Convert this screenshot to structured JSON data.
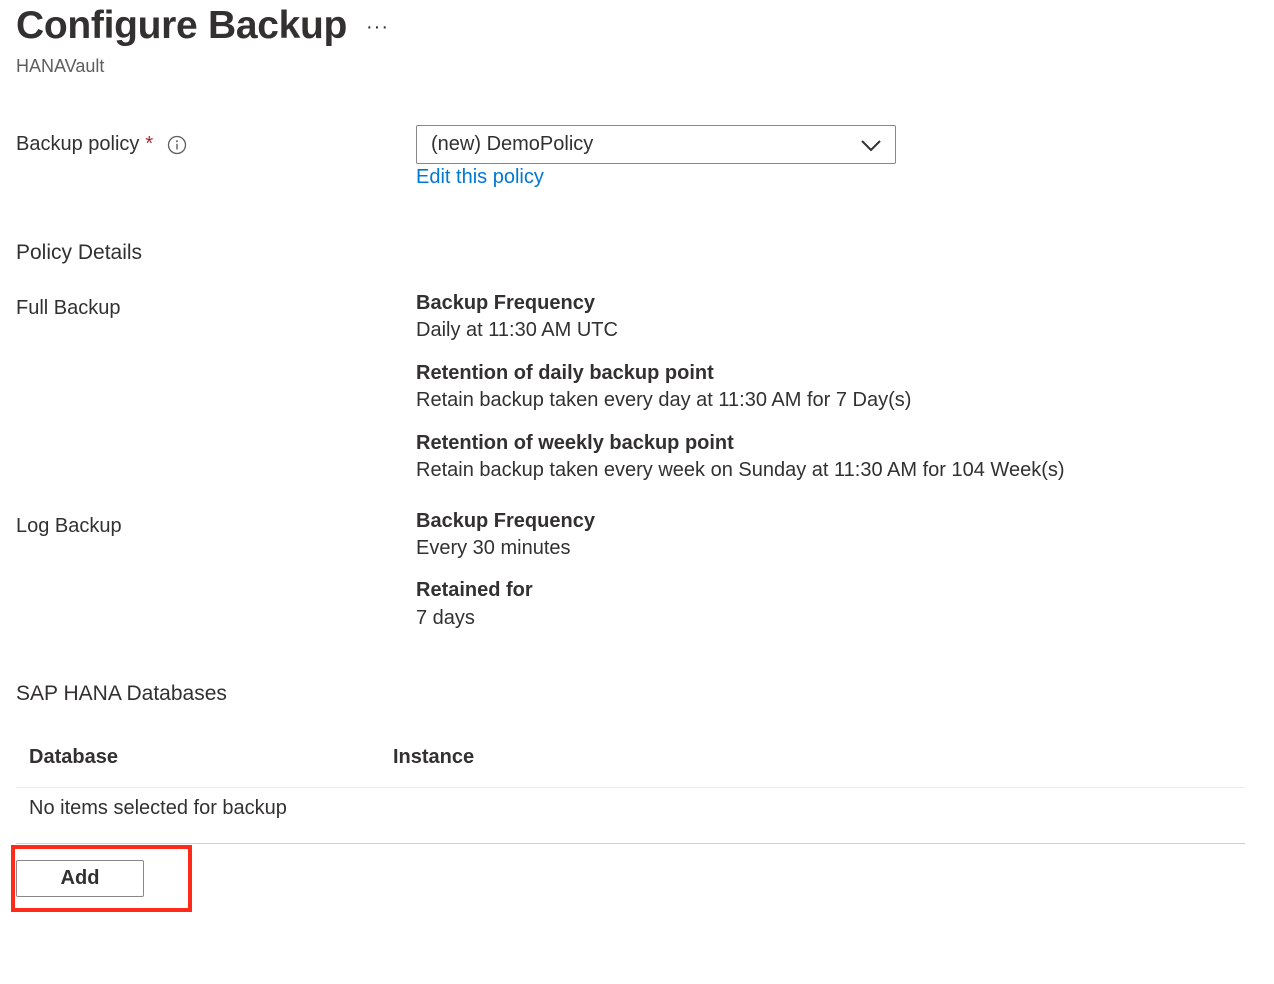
{
  "header": {
    "title": "Configure Backup",
    "more_label": "···",
    "subtitle": "HANAVault"
  },
  "policy": {
    "label": "Backup policy",
    "required_marker": "*",
    "info_icon": "info-icon",
    "selected_value": "(new) DemoPolicy",
    "edit_link": "Edit this policy"
  },
  "policy_details": {
    "title": "Policy Details",
    "full_backup": {
      "label": "Full Backup",
      "items": [
        {
          "heading": "Backup Frequency",
          "value": "Daily at 11:30 AM UTC"
        },
        {
          "heading": "Retention of daily backup point",
          "value": "Retain backup taken every day at 11:30 AM for 7 Day(s)"
        },
        {
          "heading": "Retention of weekly backup point",
          "value": "Retain backup taken every week on Sunday at 11:30 AM for 104 Week(s)"
        }
      ]
    },
    "log_backup": {
      "label": "Log Backup",
      "items": [
        {
          "heading": "Backup Frequency",
          "value": "Every 30 minutes"
        },
        {
          "heading": "Retained for",
          "value": "7 days"
        }
      ]
    }
  },
  "databases": {
    "title": "SAP HANA Databases",
    "columns": [
      "Database",
      "Instance"
    ],
    "empty_text": "No items selected for backup",
    "add_label": "Add"
  },
  "colors": {
    "link": "#0078d4",
    "required": "#a4262c",
    "highlight": "#ff2a1a"
  }
}
